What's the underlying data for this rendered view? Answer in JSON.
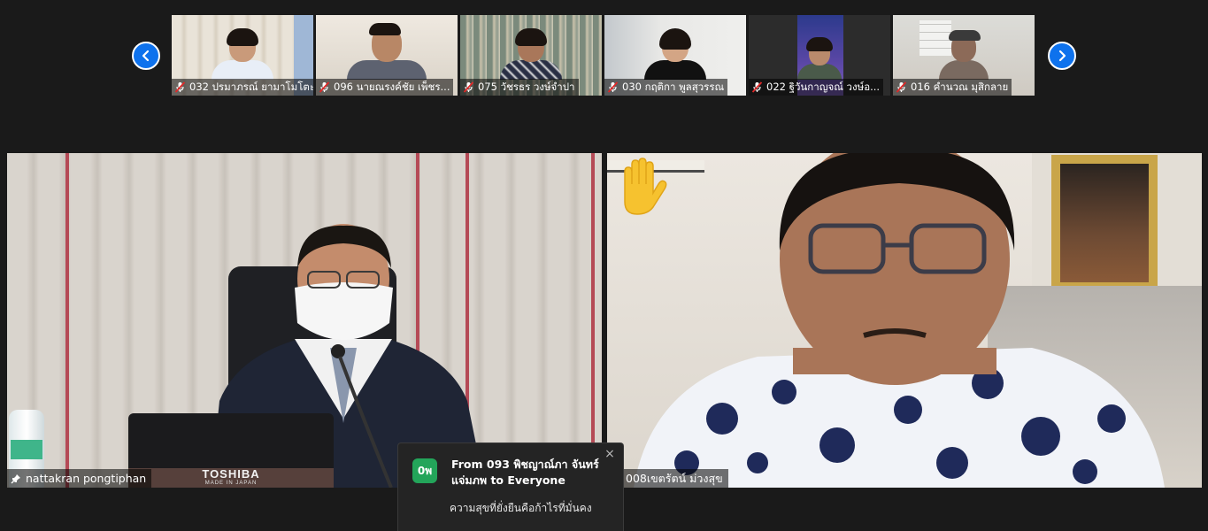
{
  "thumbnails": [
    {
      "name": "032 ปรมาภรณ์ ยามาโมโตะ"
    },
    {
      "name": "096 นายณรงค์ชัย เพ็ชร..."
    },
    {
      "name": "075 วัชรธร  วงษ์จำปา"
    },
    {
      "name": "030 กฤติกา พูลสุวรรณ"
    },
    {
      "name": "022 ฐิวันกาญจณ์  วงษ์อ..."
    },
    {
      "name": "016 คำนวณ มุสิกลาย"
    }
  ],
  "gallery_nav": {
    "prev_icon": "chevron-left-icon",
    "next_icon": "chevron-right-icon",
    "accent": "#0e72ed"
  },
  "main_tiles": [
    {
      "name": "nattakran pongtiphan",
      "laptop_brand": "TOSHIBA",
      "laptop_sub": "MADE IN JAPAN"
    },
    {
      "name": "008เขตรัตน์  ม่วงสุข",
      "reaction": "raised-hand-icon"
    }
  ],
  "chat_notification": {
    "avatar_text": "0พ",
    "from_text": "From 093 พิชญาณ์ภา จันทร์แจ่มภพ to Everyone",
    "message": "ความสุขที่ยั่งยืนคือก้าไรที่มั่นคง",
    "close_symbol": "×",
    "avatar_color": "#23a55a"
  }
}
